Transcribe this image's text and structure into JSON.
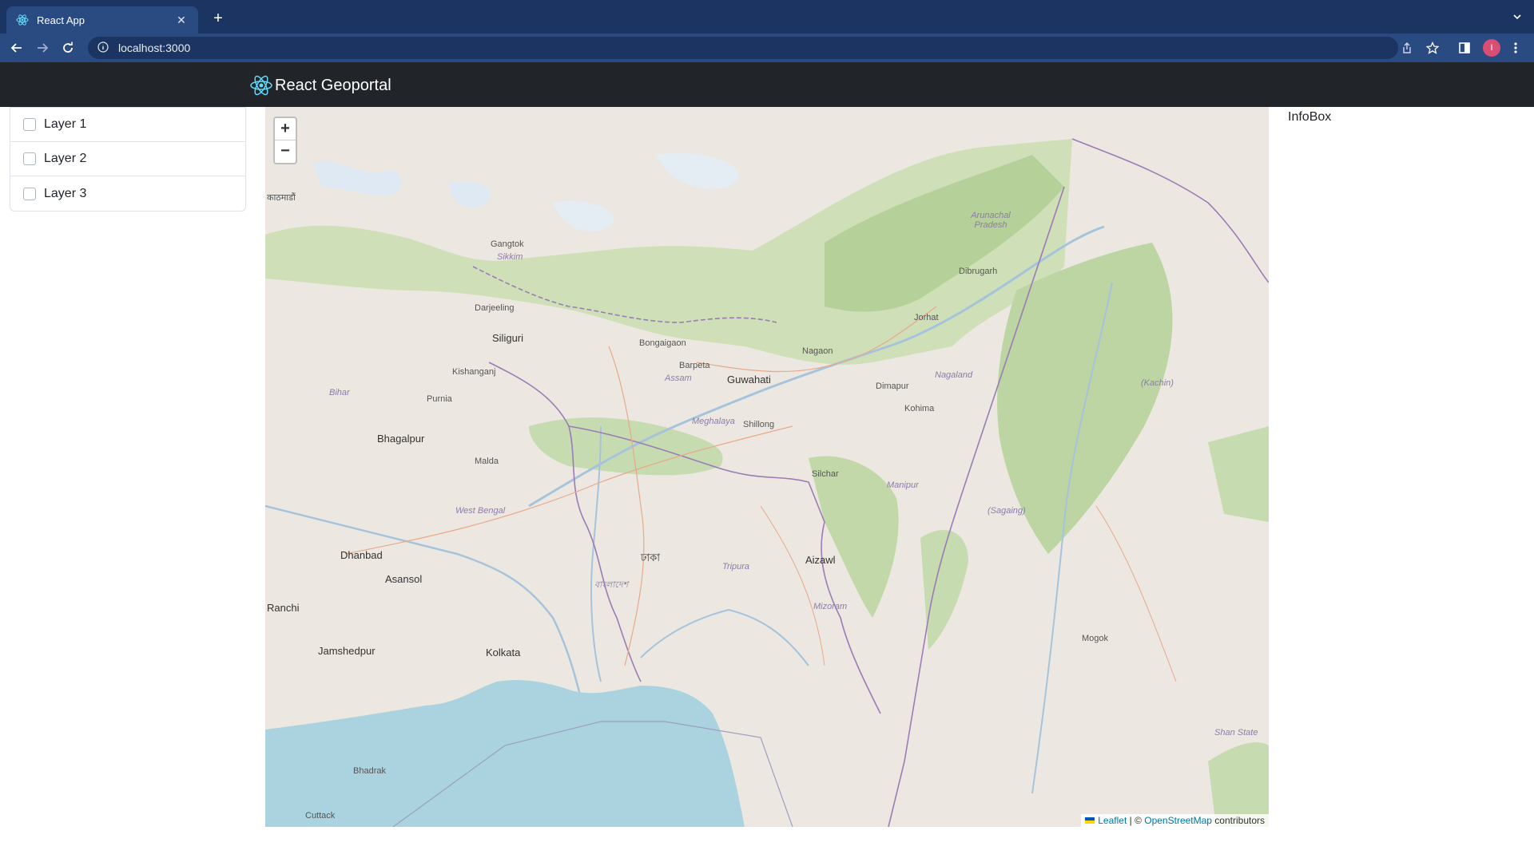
{
  "browser": {
    "tab_title": "React App",
    "url": "localhost:3000",
    "profile_initial": "I"
  },
  "header": {
    "brand": "React Geoportal"
  },
  "layers": [
    {
      "label": "Layer 1",
      "checked": false
    },
    {
      "label": "Layer 2",
      "checked": false
    },
    {
      "label": "Layer 3",
      "checked": false
    }
  ],
  "map": {
    "zoom_in": "+",
    "zoom_out": "−",
    "attribution": {
      "leaflet": "Leaflet",
      "separator": " | © ",
      "osm": "OpenStreetMap",
      "suffix": " contributors"
    },
    "places": {
      "kathmandu": "काठमाडौं",
      "sikkim": "Sikkim",
      "gangtok": "Gangtok",
      "darjeeling": "Darjeeling",
      "siliguri": "Siliguri",
      "bongaigaon": "Bongaigaon",
      "guwahati": "Guwahati",
      "assam": "Assam",
      "barpeta": "Barpeta",
      "nagaon": "Nagaon",
      "jorhat": "Jorhat",
      "dibrugarh": "Dibrugarh",
      "arunachal": "Arunachal Pradesh",
      "nagaland": "Nagaland",
      "dimapur": "Dimapur",
      "kohima": "Kohima",
      "meghalaya": "Meghalaya",
      "shillong": "Shillong",
      "silchar": "Silchar",
      "manipur": "Manipur",
      "tripura": "Tripura",
      "aizawl": "Aizawl",
      "mizoram": "Mizoram",
      "bhagalpur": "Bhagalpur",
      "dhanbad": "Dhanbad",
      "asansol": "Asansol",
      "ranchi": "Ranchi",
      "jamshedpur": "Jamshedpur",
      "kolkata": "Kolkata",
      "west_bengal": "West Bengal",
      "bihar": "Bihar",
      "purnia": "Purnia",
      "kishanganj": "Kishanganj",
      "malda": "Malda",
      "cuttack": "Cuttack",
      "bhadrak": "Bhadrak",
      "kachin": "(Kachin)",
      "sagaing": "(Sagaing)",
      "shan": "Shan State",
      "mogok": "Mogok",
      "dhaka": "ঢাকা",
      "bangladesh": "বাংলাদেশ"
    }
  },
  "infobox": {
    "title": "InfoBox"
  }
}
